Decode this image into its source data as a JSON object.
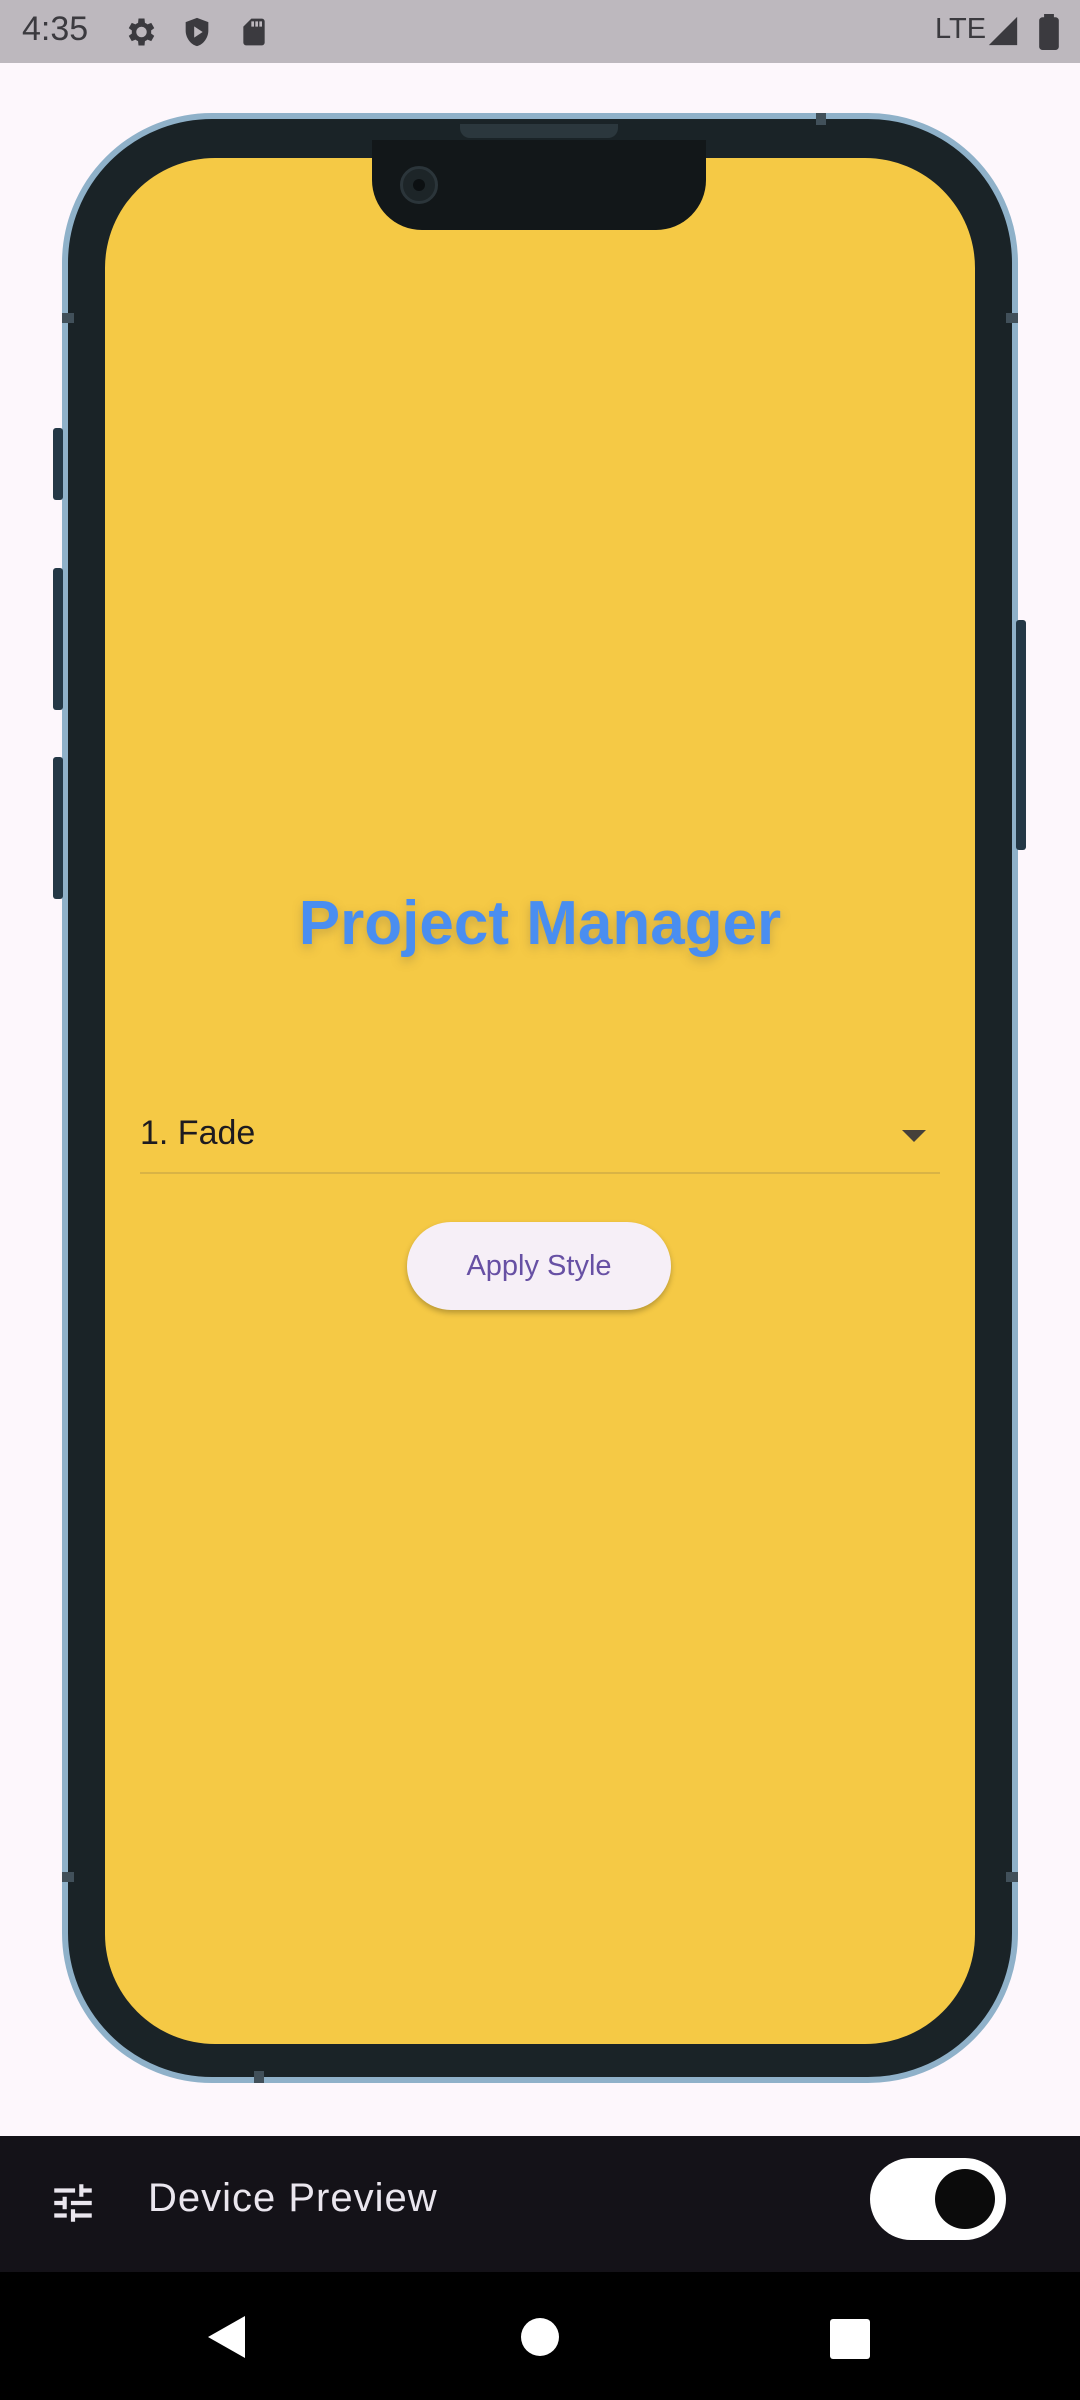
{
  "status_bar": {
    "time": "4:35",
    "network": "LTE",
    "icons": [
      "settings-gear-icon",
      "shield-play-icon",
      "sd-card-icon",
      "signal-icon",
      "battery-icon"
    ]
  },
  "app": {
    "title": "Project Manager",
    "dropdown": {
      "selected": "1. Fade"
    },
    "apply_button_label": "Apply Style"
  },
  "device_preview_bar": {
    "label": "Device Preview",
    "toggle_on": true
  },
  "nav_bar": {
    "icons": [
      "back-icon",
      "home-icon",
      "recents-icon"
    ]
  },
  "colors": {
    "screen_background": "#f5c945",
    "title": "#4a8ef0",
    "button_text": "#6750a4",
    "frame_outline": "#8fb1c9"
  }
}
